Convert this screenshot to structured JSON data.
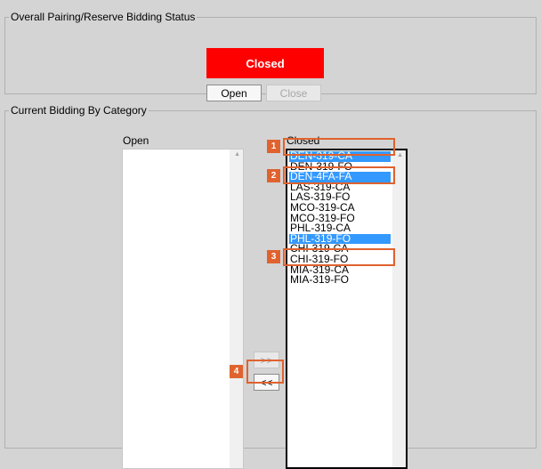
{
  "status_section": {
    "legend": "Overall Pairing/Reserve Bidding Status",
    "status_value": "Closed",
    "open_label": "Open",
    "close_label": "Close"
  },
  "category_section": {
    "legend": "Current Bidding By Category",
    "open_title": "Open",
    "closed_title": "Closed",
    "open_items": [],
    "closed_items": [
      {
        "label": "DEN-319-CA",
        "selected": true
      },
      {
        "label": "DEN-319-FO",
        "selected": false
      },
      {
        "label": "DEN-4FA-FA",
        "selected": true
      },
      {
        "label": "LAS-319-CA",
        "selected": false
      },
      {
        "label": "LAS-319-FO",
        "selected": false
      },
      {
        "label": "MCO-319-CA",
        "selected": false
      },
      {
        "label": "MCO-319-FO",
        "selected": false
      },
      {
        "label": "PHL-319-CA",
        "selected": false
      },
      {
        "label": "PHL-319-FO",
        "selected": true
      },
      {
        "label": "CHI-319-CA",
        "selected": false
      },
      {
        "label": "CHI-319-FO",
        "selected": false
      },
      {
        "label": "MIA-319-CA",
        "selected": false
      },
      {
        "label": "MIA-319-FO",
        "selected": false
      }
    ],
    "move_right_label": ">>",
    "move_left_label": "<<"
  },
  "callouts": [
    "1",
    "2",
    "3",
    "4"
  ],
  "colors": {
    "status_closed": "#ff0000",
    "selection": "#3399ff",
    "callout": "#e0622e"
  }
}
